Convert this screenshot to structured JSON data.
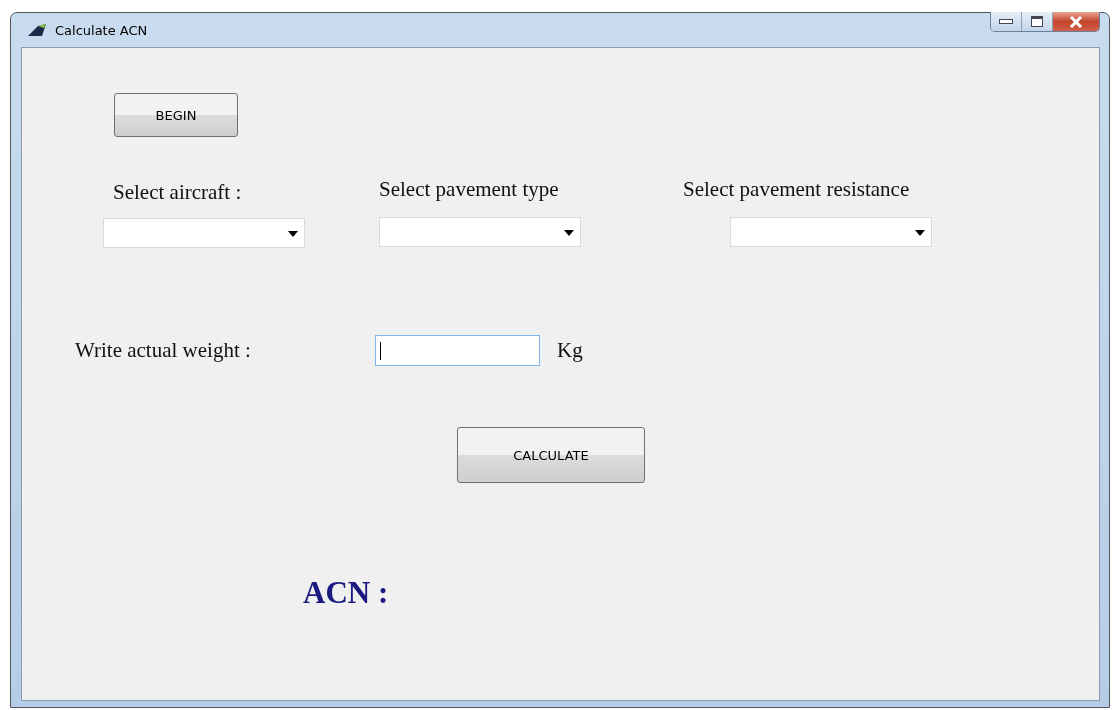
{
  "window": {
    "title": "Calculate ACN"
  },
  "begin_button": "BEGIN",
  "selectors": [
    {
      "label": "Select aircraft :"
    },
    {
      "label": "Select pavement type"
    },
    {
      "label": "Select pavement resistance"
    }
  ],
  "weight": {
    "label": "Write actual weight :",
    "unit": "Kg",
    "focused": true
  },
  "calculate_button": "CALCULATE",
  "result_label": "ACN :"
}
